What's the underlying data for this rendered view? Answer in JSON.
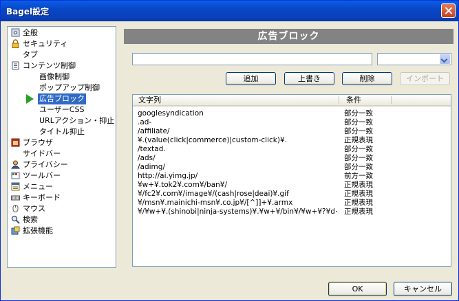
{
  "window": {
    "title": "Bagel設定"
  },
  "tree": {
    "items": [
      {
        "label": "全般",
        "icon": "gear-icon"
      },
      {
        "label": "セキュリティ",
        "icon": "lock-icon"
      },
      {
        "label": "タブ",
        "icon": ""
      },
      {
        "label": "コンテンツ制御",
        "icon": "document-icon"
      },
      {
        "label": "画像制御",
        "icon": ""
      },
      {
        "label": "ポップアップ制御",
        "icon": ""
      },
      {
        "label": "広告ブロック",
        "icon": "arrow-icon",
        "selected": true
      },
      {
        "label": "ユーザーCSS",
        "icon": ""
      },
      {
        "label": "URLアクション・抑止",
        "icon": ""
      },
      {
        "label": "タイトル抑止",
        "icon": ""
      },
      {
        "label": "ブラウザ",
        "icon": "browser-icon"
      },
      {
        "label": "サイドバー",
        "icon": ""
      },
      {
        "label": "プライバシー",
        "icon": "user-icon"
      },
      {
        "label": "ツールバー",
        "icon": "toolbar-icon"
      },
      {
        "label": "メニュー",
        "icon": "menu-icon"
      },
      {
        "label": "キーボード",
        "icon": "keyboard-icon"
      },
      {
        "label": "マウス",
        "icon": "mouse-icon"
      },
      {
        "label": "検索",
        "icon": "search-icon"
      },
      {
        "label": "拡張機能",
        "icon": "extension-icon"
      }
    ]
  },
  "panel": {
    "title": "広告ブロック"
  },
  "form": {
    "pattern_value": "",
    "condition_value": ""
  },
  "buttons": {
    "add": "追加",
    "overwrite": "上書き",
    "delete": "削除",
    "import": "インポート",
    "ok": "OK",
    "cancel": "キャンセル"
  },
  "list": {
    "headers": {
      "pattern": "文字列",
      "condition": "条件"
    },
    "rows": [
      {
        "pattern": "googlesyndication",
        "condition": "部分一致"
      },
      {
        "pattern": ".ad-",
        "condition": "部分一致"
      },
      {
        "pattern": "/affiliate/",
        "condition": "部分一致"
      },
      {
        "pattern": "¥.(value(click|commerce)|custom-click)¥.",
        "condition": "正規表現"
      },
      {
        "pattern": "/textad.",
        "condition": "部分一致"
      },
      {
        "pattern": "/ads/",
        "condition": "部分一致"
      },
      {
        "pattern": "/adimg/",
        "condition": "部分一致"
      },
      {
        "pattern": "http://ai.yimg.jp/",
        "condition": "前方一致"
      },
      {
        "pattern": "¥w+¥.tok2¥.com¥/ban¥/",
        "condition": "正規表現"
      },
      {
        "pattern": "¥/fc2¥.com¥/image¥/(cash|rose|deai)¥.gif",
        "condition": "正規表現"
      },
      {
        "pattern": "¥/msn¥.mainichi-msn¥.co.jp¥/[^]]+¥.armx",
        "condition": "正規表現"
      },
      {
        "pattern": "¥/¥w+¥.(shinobi|ninja-systems)¥.¥w+¥/bin¥/¥w+¥?¥d+",
        "condition": "正規表現"
      }
    ]
  }
}
